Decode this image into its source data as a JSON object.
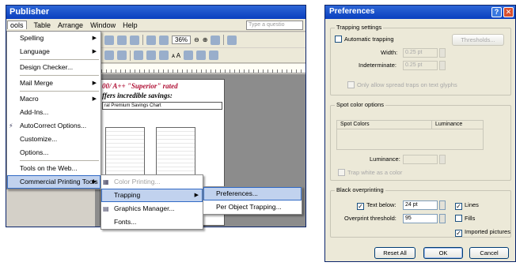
{
  "publisher": {
    "title": "Publisher",
    "menubar": [
      "ools",
      "Table",
      "Arrange",
      "Window",
      "Help"
    ],
    "ask_placeholder": "Type a questio",
    "zoom": "36%",
    "page_heading": "00/ A++ \"Superior\" rated",
    "page_subheading": "ffers incredible savings:",
    "page_box": "ral Premium Savings Chart"
  },
  "tools_menu": {
    "items": [
      {
        "label": "Spelling",
        "submenu": true
      },
      {
        "label": "Language",
        "submenu": true
      },
      {
        "label": "Design Checker..."
      },
      {
        "label": "Mail Merge",
        "submenu": true
      },
      {
        "label": "Macro",
        "submenu": true
      },
      {
        "label": "Add-Ins..."
      },
      {
        "label": "AutoCorrect Options..."
      },
      {
        "label": "Customize..."
      },
      {
        "label": "Options..."
      },
      {
        "label": "Tools on the Web..."
      },
      {
        "label": "Commercial Printing Tools",
        "submenu": true
      }
    ]
  },
  "commercial_printing_menu": {
    "items": [
      "Color Printing...",
      "Trapping",
      "Graphics Manager...",
      "Fonts..."
    ]
  },
  "trapping_menu": {
    "items": [
      "Preferences...",
      "Per Object Trapping..."
    ]
  },
  "preferences": {
    "title": "Preferences",
    "trapping_settings": {
      "legend": "Trapping settings",
      "automatic_trapping": "Automatic trapping",
      "thresholds_button": "Thresholds...",
      "width_label": "Width:",
      "width_value": "0.25 pt",
      "indeterminate_label": "Indeterminate:",
      "indeterminate_value": "0.25 pt",
      "only_allow_spread": "Only allow spread traps on text glyphs"
    },
    "spot_color_options": {
      "legend": "Spot color options",
      "col_spot": "Spot Colors",
      "col_luminance": "Luminance",
      "luminance_label": "Luminance:",
      "trap_white": "Trap white as a color"
    },
    "black_overprinting": {
      "legend": "Black overprinting",
      "text_below_label": "Text below:",
      "text_below_value": "24 pt",
      "overprint_threshold_label": "Overprint threshold:",
      "overprint_threshold_value": "95",
      "lines": "Lines",
      "fills": "Fills",
      "imported_pictures": "Imported pictures"
    },
    "buttons": {
      "reset_all": "Reset All",
      "ok": "OK",
      "cancel": "Cancel"
    }
  }
}
